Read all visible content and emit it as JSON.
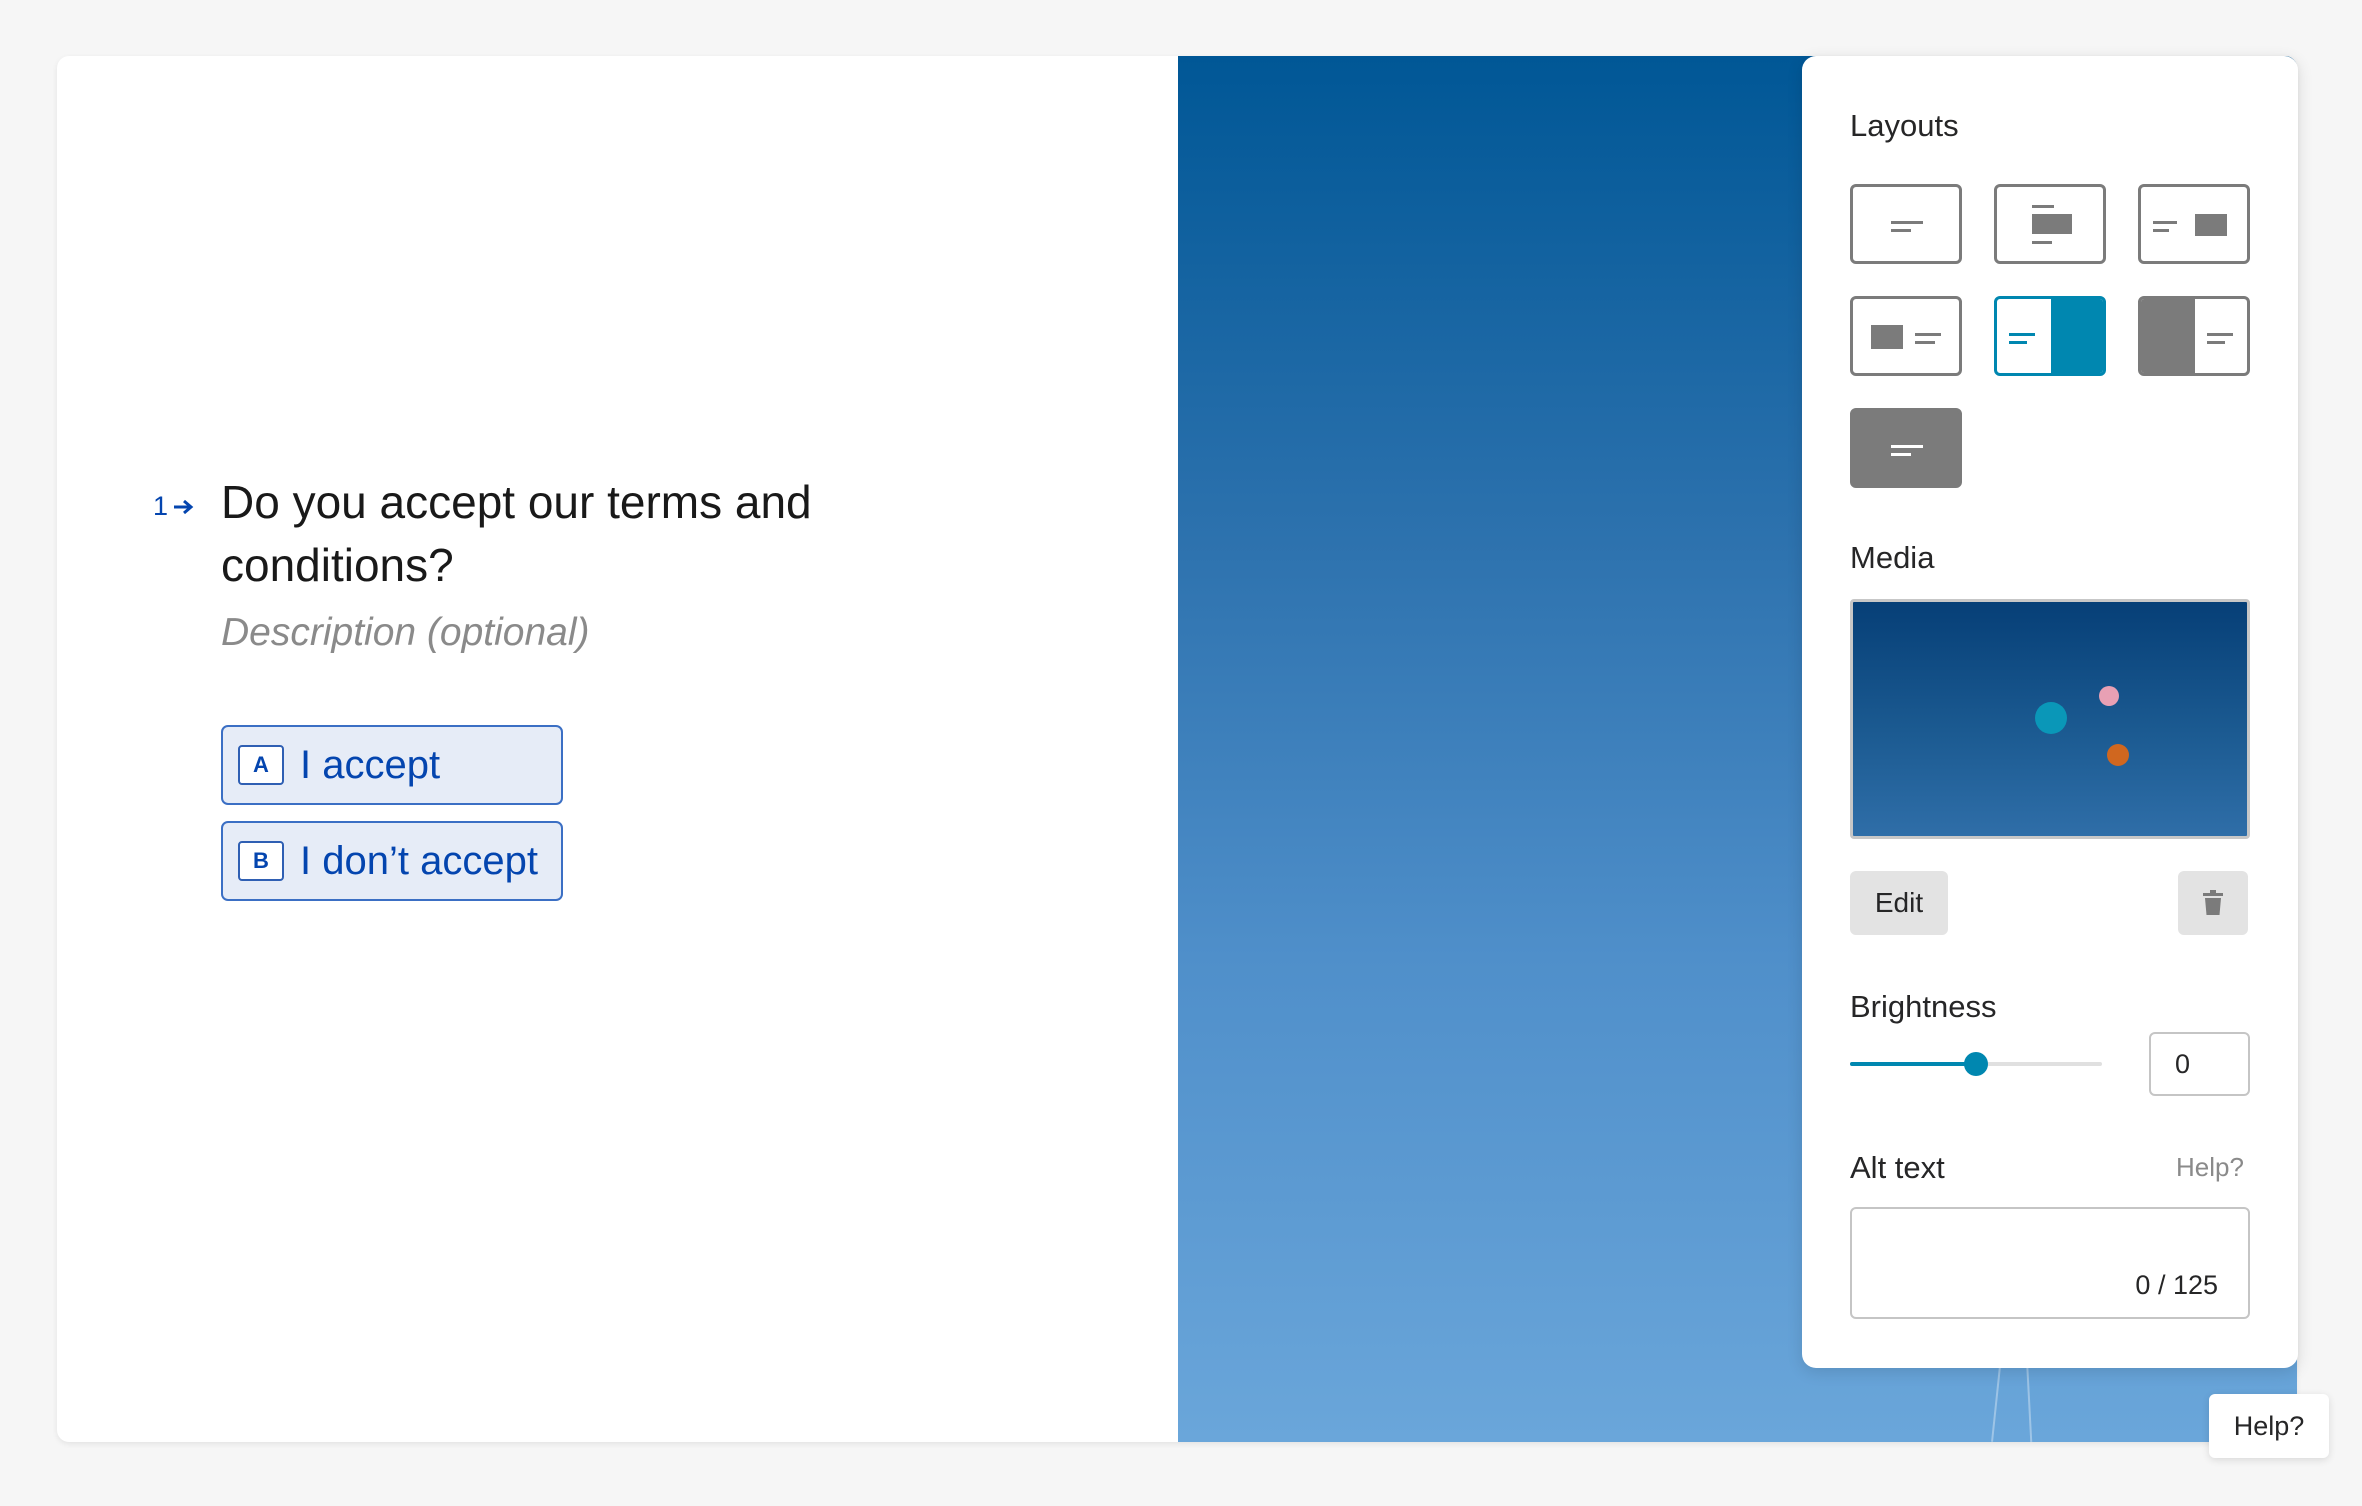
{
  "question": {
    "number": "1",
    "title": "Do you accept our terms and conditions?",
    "description_placeholder": "Description (optional)",
    "choices": [
      {
        "key": "A",
        "label": "I accept"
      },
      {
        "key": "B",
        "label": "I don’t accept"
      }
    ]
  },
  "panel": {
    "layouts_heading": "Layouts",
    "layouts": [
      {
        "name": "text-only",
        "selected": false
      },
      {
        "name": "media-above-text",
        "selected": false
      },
      {
        "name": "text-left-media-right",
        "selected": false
      },
      {
        "name": "media-left-text-right",
        "selected": false
      },
      {
        "name": "text-left-split-media-right",
        "selected": true
      },
      {
        "name": "split-media-left-text-right",
        "selected": false
      },
      {
        "name": "text-over-media-background",
        "selected": false
      }
    ],
    "media_heading": "Media",
    "edit_label": "Edit",
    "delete_icon": "trash-icon",
    "brightness_heading": "Brightness",
    "brightness_value": "0",
    "brightness_level": 0.5,
    "alt_text_heading": "Alt text",
    "alt_text_help": "Help?",
    "alt_text_counter": "0 / 125"
  },
  "help_button": "Help?",
  "colors": {
    "accent_blue": "#0445af",
    "choice_bg": "#e6ecf7",
    "active_teal": "#0087b0",
    "icon_gray": "#7b7b7b"
  }
}
